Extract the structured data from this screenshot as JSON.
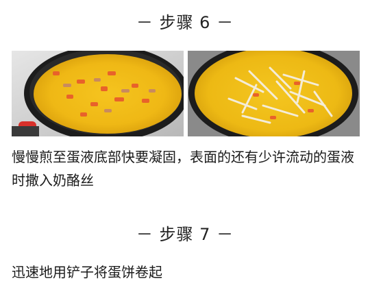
{
  "step6": {
    "heading": "－ 步骤 6 －",
    "photos": [
      {
        "icon": "pan-with-egg-and-vegetables-photo"
      },
      {
        "icon": "pan-with-egg-and-shredded-cheese-photo"
      }
    ],
    "description": "慢慢煎至蛋液底部快要凝固，表面的还有少许流动的蛋液时撒入奶酪丝"
  },
  "step7": {
    "heading": "－ 步骤 7 －",
    "description": "迅速地用铲子将蛋饼卷起"
  },
  "colors": {
    "egg": "#f2c21a",
    "pan": "#1c1c1c",
    "carrot": "#e8622a",
    "cheese": "#f4ecd8",
    "stove": "#c9c9c9"
  }
}
